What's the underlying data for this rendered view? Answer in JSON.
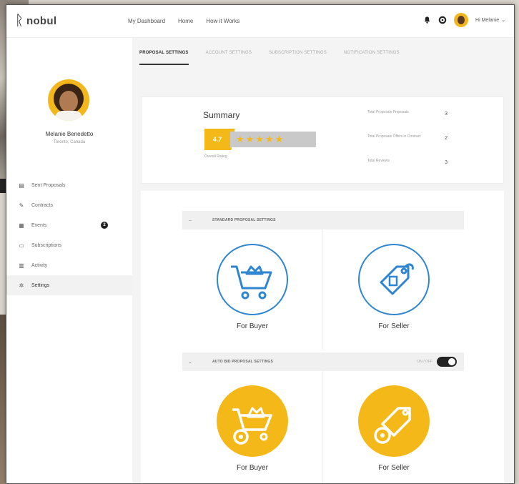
{
  "brand": {
    "name": "nobul"
  },
  "nav": {
    "items": [
      "My Dashboard",
      "Home",
      "How it Works"
    ]
  },
  "header": {
    "greeting": "Hi Melanie"
  },
  "profile": {
    "name": "Melanie Benedetto",
    "location": "Toronto, Canada"
  },
  "sidebar": {
    "items": [
      {
        "label": "Sent Proposals",
        "icon": "file-icon"
      },
      {
        "label": "Contracts",
        "icon": "pencil-icon"
      },
      {
        "label": "Events",
        "icon": "calendar-icon",
        "badge": "2"
      },
      {
        "label": "Subscriptions",
        "icon": "card-icon"
      },
      {
        "label": "Activity",
        "icon": "chart-icon"
      },
      {
        "label": "Settings",
        "icon": "gear-icon",
        "active": true
      }
    ]
  },
  "tabs": [
    {
      "label": "PROPOSAL SETTINGS",
      "active": true
    },
    {
      "label": "ACCOUNT SETTINGS"
    },
    {
      "label": "SUBSCRIPTION SETTINGS"
    },
    {
      "label": "NOTIFICATION SETTINGS"
    }
  ],
  "summary": {
    "title": "Summary",
    "score": "4.7",
    "rating_label": "Overall Rating",
    "stars": 4.7,
    "stats": [
      {
        "label": "Total Proposals Proposals",
        "value": "3"
      },
      {
        "label": "Total Proposals Offers in Contract",
        "value": "2"
      },
      {
        "label": "Total Reviews",
        "value": "3"
      }
    ]
  },
  "standard": {
    "title": "STANDARD PROPOSAL SETTINGS",
    "buyer_label": "For Buyer",
    "seller_label": "For Seller"
  },
  "autobid": {
    "title": "AUTO BID PROPOSAL SETTINGS",
    "toggle_label": "ON / OFF",
    "toggle_on": true,
    "buyer_label": "For Buyer",
    "seller_label": "For Seller"
  },
  "colors": {
    "accent": "#f4b918",
    "blue": "#2e86d0"
  }
}
